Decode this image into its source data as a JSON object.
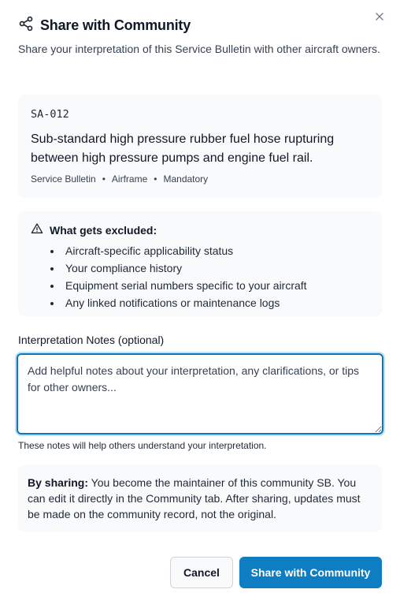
{
  "dialog": {
    "title": "Share with Community",
    "subtitle": "Share your interpretation of this Service Bulletin with other aircraft owners."
  },
  "bulletin": {
    "id": "SA-012",
    "title": "Sub-standard high pressure rubber fuel hose rupturing between high pressure pumps and engine fuel rail.",
    "type": "Service Bulletin",
    "category": "Airframe",
    "priority": "Mandatory"
  },
  "exclusions": {
    "heading": "What gets excluded:",
    "items": [
      "Aircraft-specific applicability status",
      "Your compliance history",
      "Equipment serial numbers specific to your aircraft",
      "Any linked notifications or maintenance logs"
    ]
  },
  "notes": {
    "label": "Interpretation Notes (optional)",
    "placeholder": "Add helpful notes about your interpretation, any clarifications, or tips for other owners...",
    "value": "",
    "hint": "These notes will help others understand your interpretation."
  },
  "sharing_info": {
    "bold": "By sharing:",
    "text": " You become the maintainer of this community SB. You can edit it directly in the Community tab. After sharing, updates must be made on the community record, not the original."
  },
  "buttons": {
    "cancel": "Cancel",
    "share": "Share with Community"
  },
  "icons": {
    "title": "share-icon",
    "close": "close-icon",
    "warning": "warning-icon"
  },
  "colors": {
    "primary": "#0e7dc2",
    "focus_border": "#0e77b8",
    "card_bg": "#f8fafc"
  }
}
